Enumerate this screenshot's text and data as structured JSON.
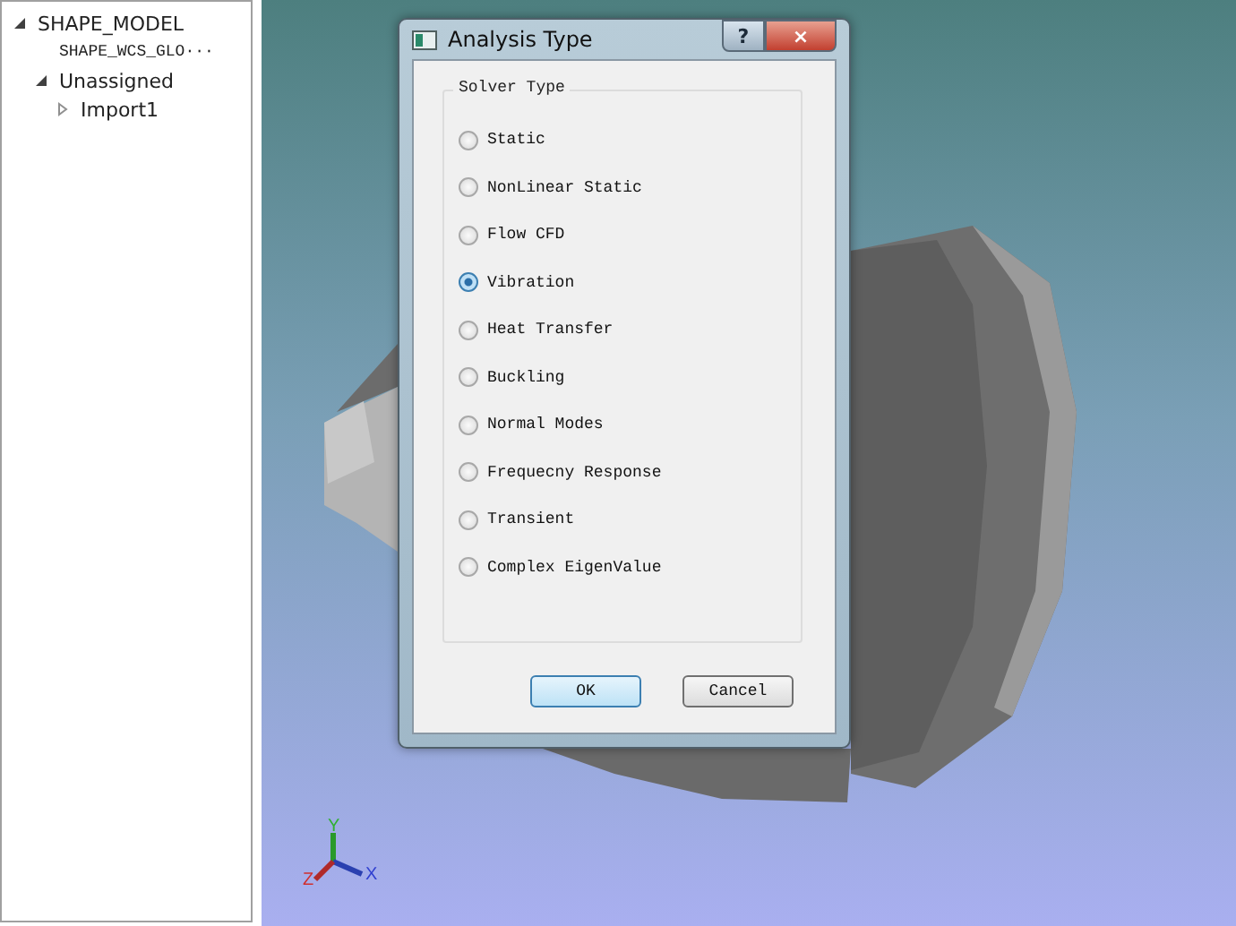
{
  "tree": [
    {
      "label": "SHAPE_MODEL",
      "expanded": true,
      "children": [
        {
          "label": "SHAPE_WCS_GLO···",
          "kind": "mono"
        },
        {
          "label": "Unassigned",
          "expanded": true,
          "children": [
            {
              "label": "Import1",
              "expanded": false
            }
          ]
        }
      ]
    }
  ],
  "axes": {
    "x": "X",
    "y": "Y",
    "z": "Z"
  },
  "dialog": {
    "title": "Analysis Type",
    "help": "?",
    "close": "×",
    "solver": {
      "title": "Solver Type",
      "options": [
        {
          "label": "Static",
          "selected": false
        },
        {
          "label": "NonLinear Static",
          "selected": false
        },
        {
          "label": "Flow CFD",
          "selected": false
        },
        {
          "label": "Vibration",
          "selected": true
        },
        {
          "label": "Heat Transfer",
          "selected": false
        },
        {
          "label": "Buckling",
          "selected": false
        },
        {
          "label": "Normal Modes",
          "selected": false
        },
        {
          "label": "Frequecny Response",
          "selected": false
        },
        {
          "label": "Transient",
          "selected": false
        },
        {
          "label": "Complex EigenValue",
          "selected": false
        }
      ]
    },
    "buttons": [
      {
        "label": "OK",
        "kind": "default"
      },
      {
        "label": "Cancel",
        "kind": "normal"
      }
    ]
  }
}
